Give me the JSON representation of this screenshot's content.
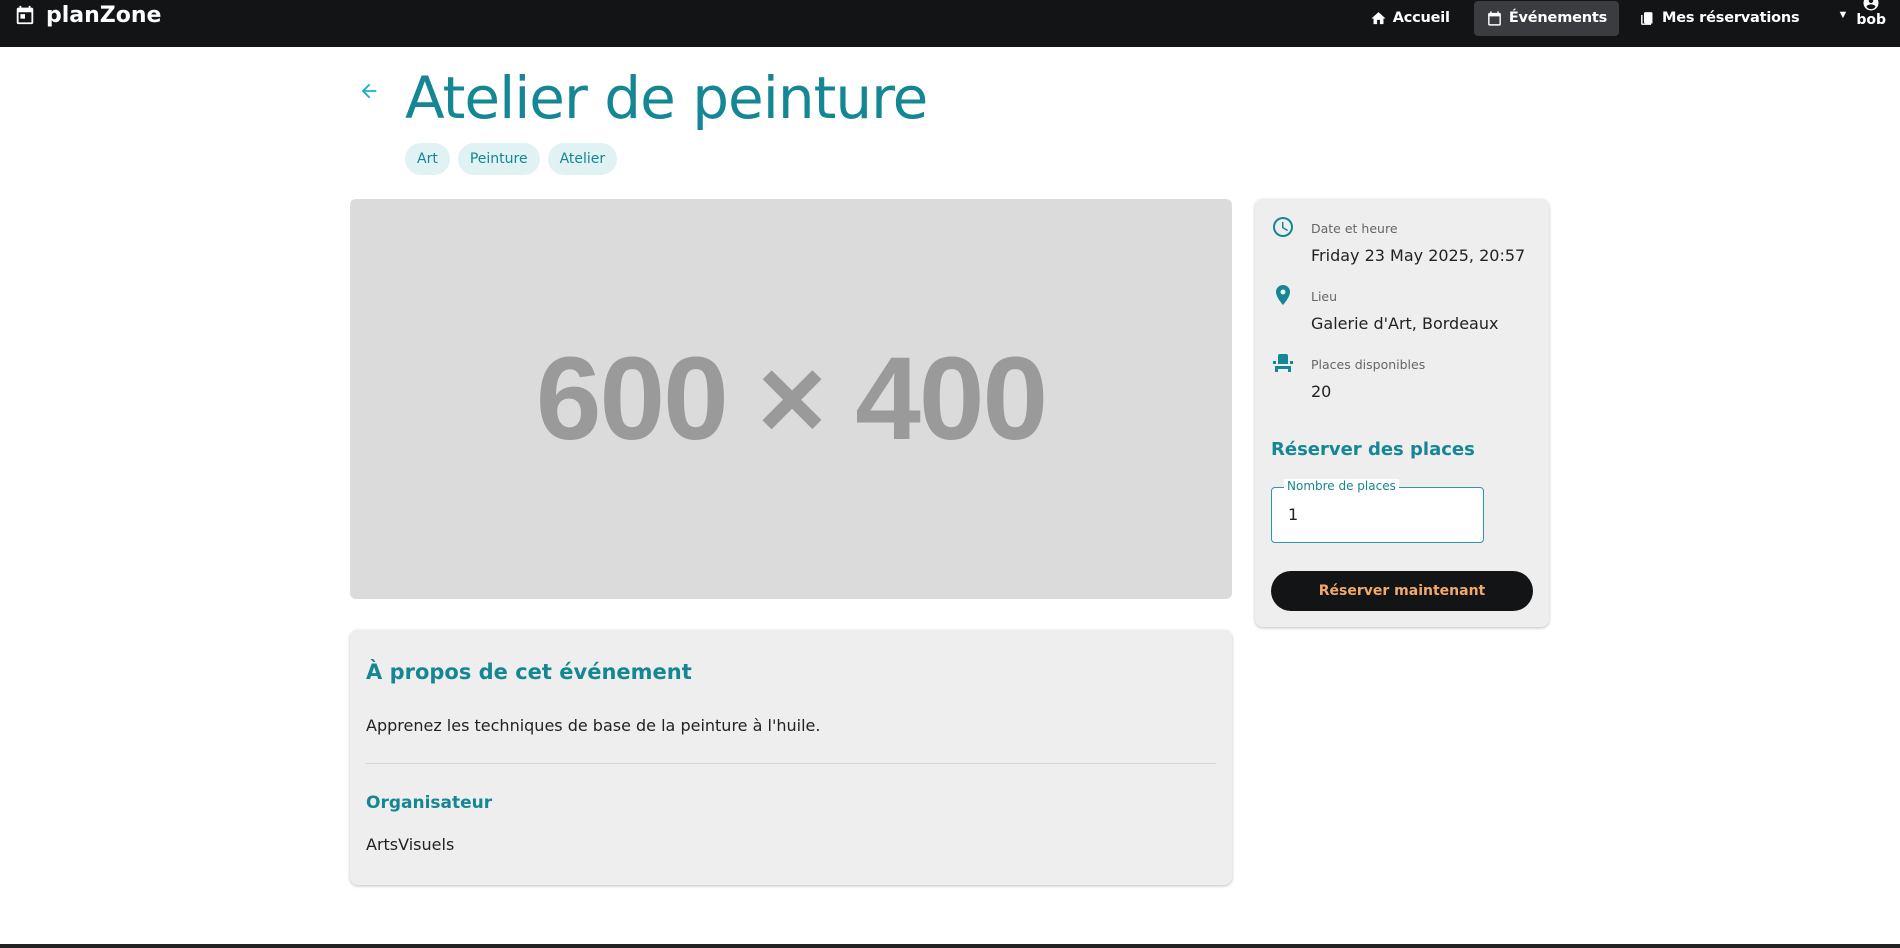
{
  "navbar": {
    "brand": "planZone",
    "items": [
      {
        "label": "Accueil",
        "icon": "home-icon"
      },
      {
        "label": "Événements",
        "icon": "calendar-icon",
        "active": true
      },
      {
        "label": "Mes réservations",
        "icon": "book-icon"
      }
    ],
    "user": "bob"
  },
  "event": {
    "title": "Atelier de peinture",
    "tags": [
      "Art",
      "Peinture",
      "Atelier"
    ],
    "image_placeholder": "600 × 400"
  },
  "about": {
    "title": "À propos de cet événement",
    "description": "Apprenez les techniques de base de la peinture à l'huile.",
    "organizer_title": "Organisateur",
    "organizer": "ArtsVisuels"
  },
  "details": {
    "date_label": "Date et heure",
    "date_value": "Friday 23 May 2025, 20:57",
    "location_label": "Lieu",
    "location_value": "Galerie d'Art, Bordeaux",
    "seats_label": "Places disponibles",
    "seats_value": "20"
  },
  "booking": {
    "title": "Réserver des places",
    "field_label": "Nombre de places",
    "field_value": "1",
    "button_label": "Réserver maintenant"
  },
  "colors": {
    "accent": "#158693",
    "navbar": "#131415",
    "button_text": "#f2a96a"
  }
}
